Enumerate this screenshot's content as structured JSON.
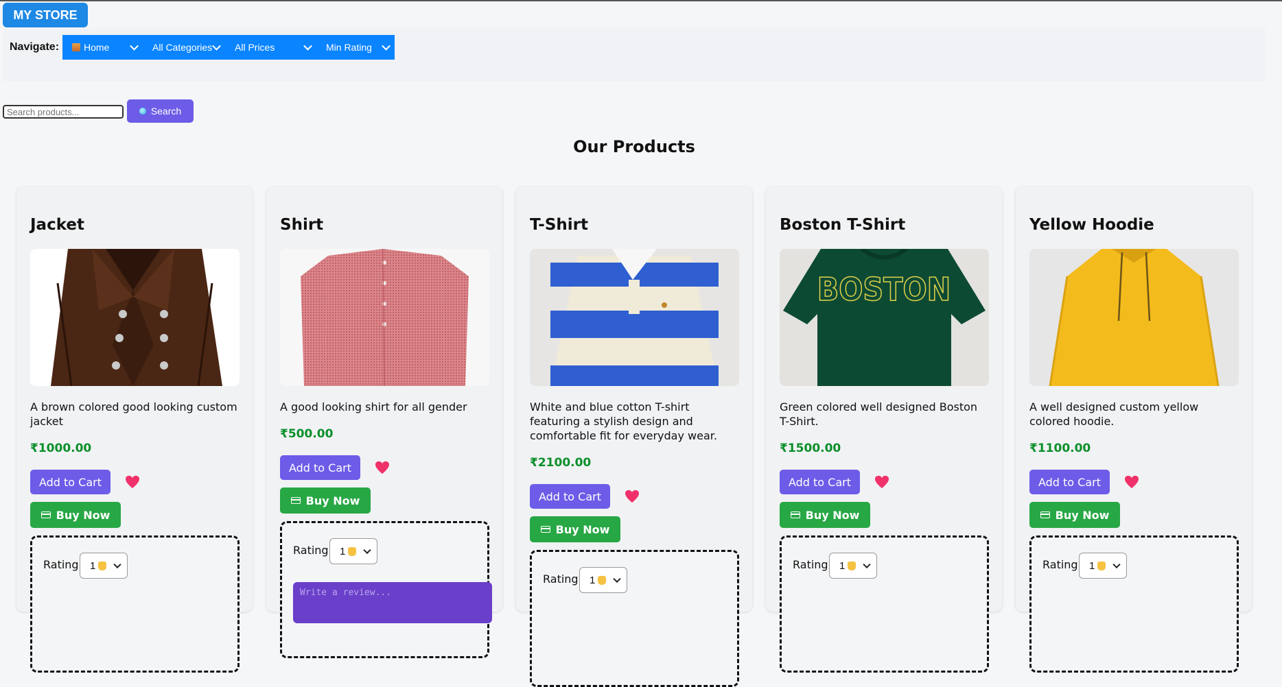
{
  "header": {
    "logo": "MY STORE",
    "nav_label": "Navigate:",
    "selects": [
      {
        "label": "Home",
        "icon": "house-icon"
      },
      {
        "label": "All Categories"
      },
      {
        "label": "All Prices"
      },
      {
        "label": "Min Rating"
      }
    ]
  },
  "search": {
    "placeholder": "Search products...",
    "button_label": "Search"
  },
  "section_title": "Our Products",
  "products": [
    {
      "name": "Jacket",
      "description": "A brown colored good looking custom jacket",
      "price": "₹1000.00",
      "add_to_cart": "Add to Cart",
      "buy_now": "Buy Now",
      "rating_label": "Rating:",
      "rating_value": "1"
    },
    {
      "name": "Shirt",
      "description": "A good looking shirt for all gender",
      "price": "₹500.00",
      "add_to_cart": "Add to Cart",
      "buy_now": "Buy Now",
      "rating_label": "Rating:",
      "rating_value": "1",
      "review_placeholder": "Write a review..."
    },
    {
      "name": "T-Shirt",
      "description": "White and blue cotton T-shirt featuring a stylish design and comfortable fit for everyday wear.",
      "price": "₹2100.00",
      "add_to_cart": "Add to Cart",
      "buy_now": "Buy Now",
      "rating_label": "Rating:",
      "rating_value": "1"
    },
    {
      "name": "Boston T-Shirt",
      "description": "Green colored well designed Boston T-Shirt.",
      "price": "₹1500.00",
      "add_to_cart": "Add to Cart",
      "buy_now": "Buy Now",
      "rating_label": "Rating:",
      "rating_value": "1",
      "image_text": "BOSTON"
    },
    {
      "name": "Yellow Hoodie",
      "description": "A well designed custom yellow colored hoodie.",
      "price": "₹1100.00",
      "add_to_cart": "Add to Cart",
      "buy_now": "Buy Now",
      "rating_label": "Rating:",
      "rating_value": "1"
    }
  ],
  "colors": {
    "primary_blue": "#0a84ff",
    "purple": "#6c5ce7",
    "green": "#28a745",
    "price_green": "#0a8f2a"
  }
}
